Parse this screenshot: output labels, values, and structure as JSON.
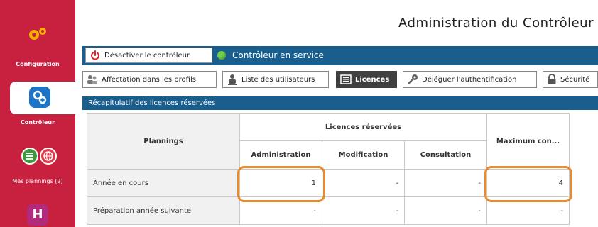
{
  "sidebar": {
    "items": [
      {
        "label": "Configuration"
      },
      {
        "label": "Contrôleur"
      },
      {
        "label": "Mes plannings (2)"
      }
    ]
  },
  "header": {
    "title": "Administration du Contrôleur"
  },
  "toolbar": {
    "deactivate_label": "Désactiver le contrôleur",
    "status_label": "Contrôleur en service"
  },
  "tabs": [
    {
      "label": "Affectation dans les profils"
    },
    {
      "label": "Liste des utilisateurs"
    },
    {
      "label": "Licences"
    },
    {
      "label": "Déléguer l'authentification"
    },
    {
      "label": "Sécurité"
    }
  ],
  "section": {
    "title": "Récapitulatif des licences réservées"
  },
  "table": {
    "col_plannings": "Plannings",
    "group_header": "Licences réservées",
    "col_admin": "Administration",
    "col_modif": "Modification",
    "col_consult": "Consultation",
    "col_max": "Maximum con...",
    "rows": [
      {
        "label": "Année en cours",
        "admin": "1",
        "modif": "-",
        "consult": "-",
        "max": "4"
      },
      {
        "label": "Préparation année suivante",
        "admin": "-",
        "modif": "-",
        "consult": "-",
        "max": "-"
      }
    ]
  },
  "colors": {
    "sidebar": "#c7213f",
    "bar": "#1a5e8e",
    "highlight": "#e88a2e",
    "status_dot": "#6fd04a"
  }
}
